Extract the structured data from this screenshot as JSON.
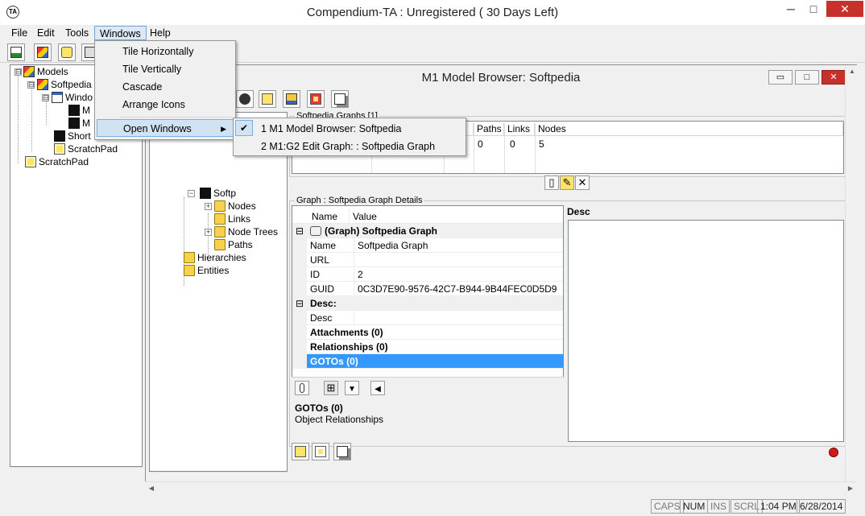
{
  "app": {
    "title": "Compendium-TA : Unregistered ( 30 Days Left)",
    "icon_text": "TA"
  },
  "window_controls": {
    "minimize": "─",
    "maximize": "□",
    "close": "✕"
  },
  "menubar": {
    "items": [
      {
        "label": "File"
      },
      {
        "label": "Edit"
      },
      {
        "label": "Tools"
      },
      {
        "label": "Windows",
        "active": true
      },
      {
        "label": "Help"
      }
    ]
  },
  "windows_menu": {
    "items": [
      {
        "label": "Tile Horizontally"
      },
      {
        "label": "Tile Vertically"
      },
      {
        "label": "Cascade"
      },
      {
        "label": "Arrange Icons"
      },
      {
        "label": "Open Windows",
        "highlighted": true,
        "has_submenu": true
      }
    ],
    "submenu_arrow": "▶"
  },
  "open_windows_submenu": {
    "check_glyph": "✔",
    "items": [
      {
        "label": "1 M1 Model Browser: Softpedia",
        "checked": true
      },
      {
        "label": "2 M1:G2 Edit Graph:  : Softpedia Graph",
        "checked": false
      }
    ]
  },
  "left_tree": {
    "items": [
      {
        "label": "Models",
        "icon": "models-icon"
      },
      {
        "label": "Softpedia",
        "icon": "models-icon"
      },
      {
        "label": "Windo",
        "icon": "window-icon"
      },
      {
        "label": "M",
        "icon": "graph-icon"
      },
      {
        "label": "M",
        "icon": "graph-icon"
      },
      {
        "label": "Short",
        "icon": "shortcut-icon"
      },
      {
        "label": "ScratchPad",
        "icon": "scratchpad-icon"
      },
      {
        "label": "ScratchPad",
        "icon": "scratchpad-icon"
      }
    ],
    "expanders": [
      "⊟",
      "⊟",
      "⊟"
    ]
  },
  "child_window": {
    "title": "M1 Model Browser: Softpedia",
    "controls": {
      "minimize": "▭",
      "maximize": "□",
      "close": "✕"
    }
  },
  "inner_tree": {
    "items": [
      {
        "label": "Softp",
        "icon": "graph-icon"
      },
      {
        "label": "Nodes",
        "icon": "folder-icon"
      },
      {
        "label": "Links",
        "icon": "folder-icon"
      },
      {
        "label": "Node Trees",
        "icon": "folder-icon"
      },
      {
        "label": "Paths",
        "icon": "folder-icon"
      },
      {
        "label": "Hierarchies",
        "icon": "folder-icon"
      },
      {
        "label": "Entities",
        "icon": "folder-icon"
      }
    ],
    "expander_plus": "+",
    "expander_minus": "−"
  },
  "graphs_panel": {
    "legend": "Softpedia Graphs [1]",
    "columns": [
      "Paths",
      "Links",
      "Nodes"
    ],
    "rows": [
      {
        "paths": "0",
        "links": "0",
        "nodes": "5"
      }
    ],
    "button_glyphs": {
      "new": "▯",
      "edit": "✎",
      "delete": "✕"
    }
  },
  "details_panel": {
    "legend": "Graph : Softpedia Graph Details",
    "header": {
      "name": "Name",
      "value": "Value"
    },
    "category": "(Graph) Softpedia Graph",
    "collapse_glyph": "⊟",
    "rows": [
      {
        "name": "Name",
        "value": "Softpedia Graph"
      },
      {
        "name": "URL",
        "value": ""
      },
      {
        "name": "ID",
        "value": "2"
      },
      {
        "name": "GUID",
        "value": "0C3D7E90-9576-42C7-B944-9B44FEC0D5D9"
      }
    ],
    "desc_category": "Desc:",
    "desc_row": {
      "name": "Desc",
      "value": ""
    },
    "attachments": "Attachments (0)",
    "relationships": "Relationships (0)",
    "gotos": "GOTOs (0)",
    "info_title": "GOTOs (0)",
    "info_text": "Object Relationships",
    "toolbar_glyphs": {
      "clip": "📎",
      "props": "⊞",
      "dropdown": "▼",
      "back": "◀"
    }
  },
  "desc_panel": {
    "label": "Desc"
  },
  "statusbar": {
    "caps": "CAPS",
    "num": "NUM",
    "ins": "INS",
    "scrl": "SCRL",
    "time": "1:04 PM",
    "date": "6/28/2014"
  },
  "colors": {
    "selection": "#3399ff",
    "menu_highlight": "#d1e2f2",
    "close_button": "#c7312b"
  }
}
